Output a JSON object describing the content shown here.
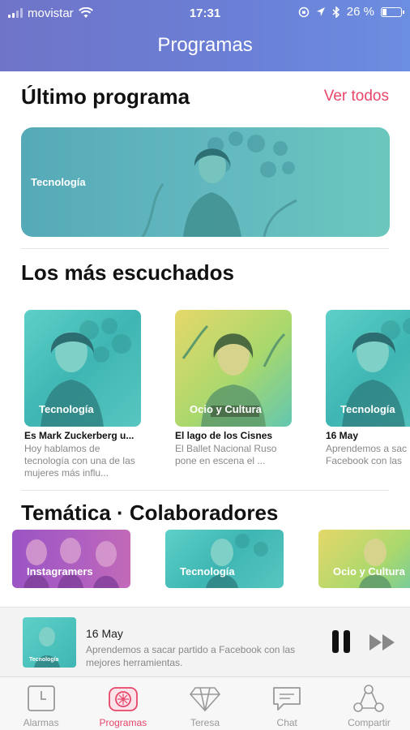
{
  "status_bar": {
    "carrier": "movistar",
    "time": "17:31",
    "battery": "26 %",
    "battery_level": 0.26
  },
  "header": {
    "title": "Programas"
  },
  "latest": {
    "heading": "Último programa",
    "see_all": "Ver todos",
    "category": "Tecnología"
  },
  "most_listened": {
    "heading": "Los más escuchados",
    "cards": [
      {
        "category": "Tecnología",
        "title": "Es Mark Zuckerberg u...",
        "desc": "Hoy hablamos de tecnología con una de las mujeres más influ..."
      },
      {
        "category": "Ocio y Cultura",
        "title": "El lago de los Cisnes",
        "desc": "El Ballet Nacional Ruso pone en escena el ..."
      },
      {
        "category": "Tecnología",
        "title": "16 May",
        "desc": "Aprendemos a sac Facebook con las"
      }
    ]
  },
  "thematic": {
    "heading": "Temática · Colaboradores",
    "items": [
      {
        "label": "Instagramers"
      },
      {
        "label": "Tecnología"
      },
      {
        "label": "Ocio y Cultura"
      }
    ]
  },
  "player": {
    "thumb_category": "Tecnología",
    "date": "16 May",
    "desc": "Aprendemos a sacar partido a Facebook con las mejores herramientas."
  },
  "tabs": [
    {
      "label": "Alarmas",
      "icon": "alarm-clock-icon",
      "active": false
    },
    {
      "label": "Programas",
      "icon": "radio-icon",
      "active": true
    },
    {
      "label": "Teresa",
      "icon": "diamond-icon",
      "active": false
    },
    {
      "label": "Chat",
      "icon": "chat-bubble-icon",
      "active": false
    },
    {
      "label": "Compartir",
      "icon": "share-icon",
      "active": false
    }
  ],
  "colors": {
    "accent": "#e84669",
    "header_start": "#6f74c8",
    "header_end": "#6c8ee0"
  }
}
